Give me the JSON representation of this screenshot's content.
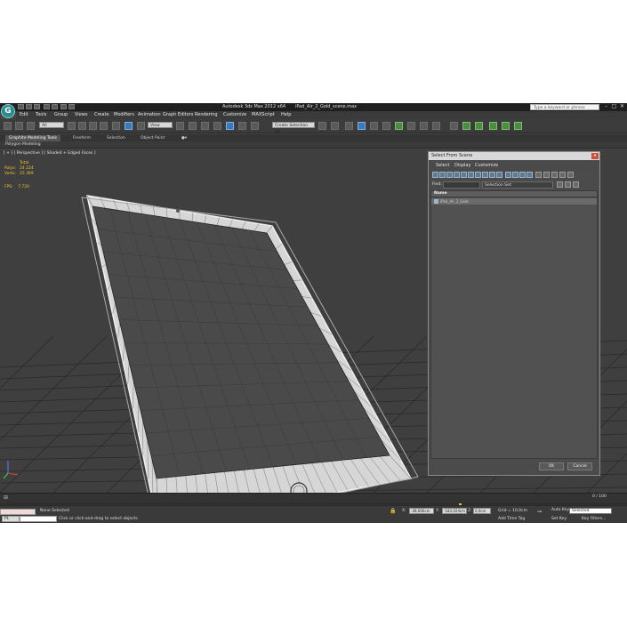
{
  "titlebar": {
    "app": "Autodesk 3ds Max 2012 x64",
    "file": "iPad_Air_2_Gold_scene.max",
    "search_placeholder": "Type a keyword or phrase",
    "logo": "G"
  },
  "menus": [
    "Edit",
    "Tools",
    "Group",
    "Views",
    "Create",
    "Modifiers",
    "Animation",
    "Graph Editors",
    "Rendering",
    "Customize",
    "MAXScript",
    "Help"
  ],
  "toolbar": {
    "filter_value": "All",
    "view_value": "View",
    "named_selection": "Create Selection Se"
  },
  "ribbon": {
    "tabs": [
      "Graphite Modeling Tools",
      "Freeform",
      "Selection",
      "Object Paint"
    ],
    "panel_label": "Polygon Modeling"
  },
  "viewport": {
    "label": "[ + ] [ Perspective ] [ Shaded + Edged Faces ]",
    "stats_header": "Total",
    "polys_label": "Polys:",
    "polys_value": "24 224",
    "verts_label": "Verts:",
    "verts_value": "25 369",
    "fps_label": "FPS:",
    "fps_value": "7,720"
  },
  "dialog": {
    "title": "Select From Scene",
    "close": "x",
    "menus": [
      "Select",
      "Display",
      "Customize"
    ],
    "find_label": "Find:",
    "selection_set": "Selection Set:",
    "column_name": "Name",
    "rows": [
      "iPad_Air_2_Gold"
    ],
    "ok": "OK",
    "cancel": "Cancel"
  },
  "timeline": {
    "frame": "0 / 100"
  },
  "statusbar": {
    "listener": "PL",
    "selection": "None Selected",
    "prompt": "Click or click-and-drag to select objects",
    "x_label": "X:",
    "x_value": "-48,666cm",
    "y_label": "Y:",
    "y_value": "-183,024cm",
    "z_label": "Z:",
    "z_value": "0,0cm",
    "grid": "Grid = 10,0cm",
    "add_time_tag": "Add Time Tag",
    "auto_key": "Auto Key",
    "selected": "Selected",
    "set_key": "Set Key",
    "key_filters": "Key Filters..."
  },
  "colors": {
    "viewport_bg": "#3f3f3f",
    "wire_white": "#e8e8e8",
    "screen": "#4a4a4a",
    "accent": "#3b78b8",
    "stats_yellow": "#f2c233"
  }
}
